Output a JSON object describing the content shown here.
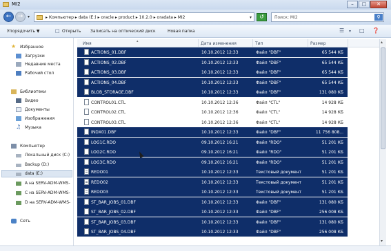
{
  "window": {
    "title": "MI2",
    "buttons": [
      "–",
      "□",
      "✕"
    ]
  },
  "nav": {
    "address": "▸ Компьютер ▸ data (E:) ▸ oracle ▸ product ▸ 10.2.0 ▸ oradata ▸ MI2",
    "search_text": "Поиск: MI2"
  },
  "toolbar": {
    "organize": "Упорядочить ▼",
    "open": "Открыть",
    "burn": "Записать на оптический диск",
    "new_folder": "Новая папка"
  },
  "sidebar": {
    "favorites": "Избранное",
    "downloads": "Загрузки",
    "recent": "Недавние места",
    "desktop": "Рабочий стол",
    "libraries": "Библиотеки",
    "video": "Видео",
    "documents": "Документы",
    "images": "Изображения",
    "music": "Музыка",
    "computer": "Компьютер",
    "local_c": "Локальный диск (C:)",
    "backup_d": "Backup (D:)",
    "data_e": "data (E:)",
    "net_a": "A на SERV-ADM-WMS-",
    "net_c": "C на SERV-ADM-WMS-",
    "net_d": "D на SERV-ADM-WMS-",
    "network": "Сеть"
  },
  "columns": {
    "name": "Имя",
    "date": "Дата изменения",
    "type": "Тип",
    "size": "Размер"
  },
  "files": [
    {
      "name": "ACTIONS_01.DBF",
      "date": "10.10.2012 12:33",
      "type": "Файл \"DBF\"",
      "size": "65 544 КБ",
      "sel": true
    },
    {
      "name": "ACTIONS_02.DBF",
      "date": "10.10.2012 12:33",
      "type": "Файл \"DBF\"",
      "size": "65 544 КБ",
      "sel": true
    },
    {
      "name": "ACTIONS_03.DBF",
      "date": "10.10.2012 12:33",
      "type": "Файл \"DBF\"",
      "size": "65 544 КБ",
      "sel": true
    },
    {
      "name": "ACTIONS_04.DBF",
      "date": "10.10.2012 12:33",
      "type": "Файл \"DBF\"",
      "size": "65 544 КБ",
      "sel": true
    },
    {
      "name": "BLOB_STORAGE.DBF",
      "date": "10.10.2012 12:33",
      "type": "Файл \"DBF\"",
      "size": "131 080 КБ",
      "sel": true
    },
    {
      "name": "CONTROL01.CTL",
      "date": "10.10.2012 12:36",
      "type": "Файл \"CTL\"",
      "size": "14 928 КБ",
      "sel": false
    },
    {
      "name": "CONTROL02.CTL",
      "date": "10.10.2012 12:36",
      "type": "Файл \"CTL\"",
      "size": "14 928 КБ",
      "sel": false
    },
    {
      "name": "CONTROL03.CTL",
      "date": "10.10.2012 12:36",
      "type": "Файл \"CTL\"",
      "size": "14 928 КБ",
      "sel": false
    },
    {
      "name": "INDX01.DBF",
      "date": "10.10.2012 12:33",
      "type": "Файл \"DBF\"",
      "size": "11 756 808...",
      "sel": true
    },
    {
      "name": "LOG1C.RDO",
      "date": "09.10.2012 16:21",
      "type": "Файл \"RDO\"",
      "size": "51 201 КБ",
      "sel": true
    },
    {
      "name": "LOG2C.RDO",
      "date": "09.10.2012 16:21",
      "type": "Файл \"RDO\"",
      "size": "51 201 КБ",
      "sel": true
    },
    {
      "name": "LOG3C.RDO",
      "date": "09.10.2012 16:21",
      "type": "Файл \"RDO\"",
      "size": "51 201 КБ",
      "sel": true
    },
    {
      "name": "REDO01",
      "date": "10.10.2012 12:33",
      "type": "Текстовый документ",
      "size": "51 201 КБ",
      "sel": true
    },
    {
      "name": "REDO02",
      "date": "10.10.2012 12:33",
      "type": "Текстовый документ",
      "size": "51 201 КБ",
      "sel": true
    },
    {
      "name": "REDO03",
      "date": "10.10.2012 12:33",
      "type": "Текстовый документ",
      "size": "51 201 КБ",
      "sel": true
    },
    {
      "name": "ST_BAR_JOBS_01.DBF",
      "date": "10.10.2012 12:33",
      "type": "Файл \"DBF\"",
      "size": "131 080 КБ",
      "sel": true
    },
    {
      "name": "ST_BAR_JOBS_02.DBF",
      "date": "10.10.2012 12:33",
      "type": "Файл \"DBF\"",
      "size": "256 008 КБ",
      "sel": true
    },
    {
      "name": "ST_BAR_JOBS_03.DBF",
      "date": "10.10.2012 12:33",
      "type": "Файл \"DBF\"",
      "size": "131 080 КБ",
      "sel": true
    },
    {
      "name": "ST_BAR_JOBS_04.DBF",
      "date": "10.10.2012 12:33",
      "type": "Файл \"DBF\"",
      "size": "256 008 КБ",
      "sel": true
    }
  ]
}
